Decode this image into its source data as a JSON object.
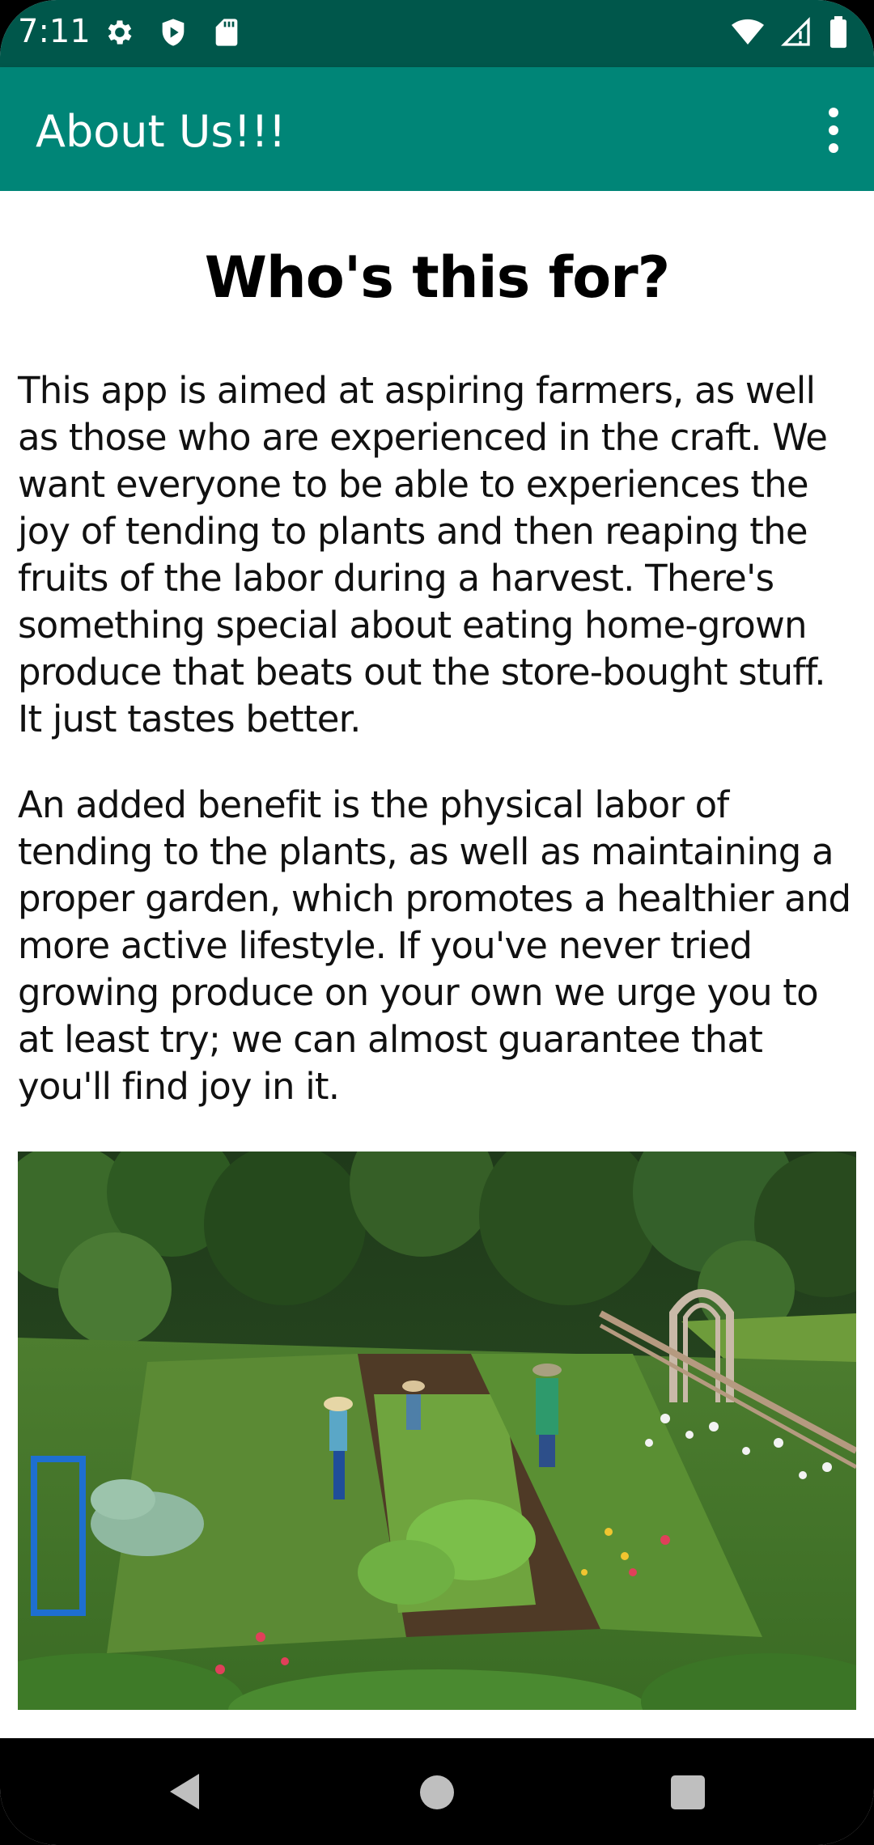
{
  "status_bar": {
    "time": "7:11",
    "left_icons": [
      "gear-icon",
      "shield-icon",
      "sd-card-icon"
    ],
    "right_icons": [
      "wifi-icon",
      "cell-signal-icon",
      "battery-icon"
    ],
    "bg_color": "#00574B"
  },
  "app_bar": {
    "title": "About Us!!!",
    "overflow_icon": "more-vert-icon",
    "bg_color": "#008577"
  },
  "content": {
    "heading": "Who's this for?",
    "paragraph_1": "This app is aimed at aspiring farmers, as well as those who are experienced in the craft. We want everyone to be able to experiences the joy of tending to plants and then reaping the fruits of the labor during a harvest. There's something special about eating home-grown produce that beats out the store-bought stuff. It just tastes better.",
    "paragraph_2": "An added benefit is the physical labor of tending to the plants, as well as maintaining a proper garden, which promotes a healthier and more active lifestyle. If you've never tried growing produce on your own we urge you to at least try; we can almost guarantee that you'll find joy in it.",
    "image": "garden-photo"
  },
  "nav_bar": {
    "buttons": [
      "back-icon",
      "home-icon",
      "recents-icon"
    ]
  }
}
